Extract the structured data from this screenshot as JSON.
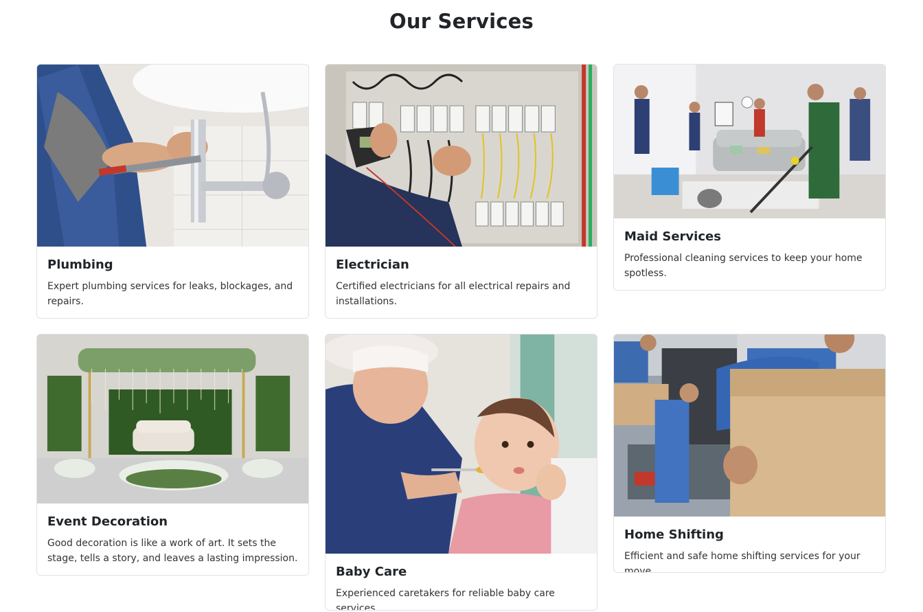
{
  "page": {
    "title": "Our Services"
  },
  "services": [
    {
      "title": "Plumbing",
      "description": "Expert plumbing services for leaks, blockages, and repairs.",
      "image": "plumber-repairing-sink-photo"
    },
    {
      "title": "Electrician",
      "description": "Certified electricians for all electrical repairs and installations.",
      "image": "electrician-testing-panel-photo"
    },
    {
      "title": "Maid Services",
      "description": "Professional cleaning services to keep your home spotless.",
      "image": "cleaning-team-living-room-photo"
    },
    {
      "title": "Event Decoration",
      "description": "Good decoration is like a work of art. It sets the stage, tells a story, and leaves a lasting impression.",
      "image": "floral-event-stage-photo"
    },
    {
      "title": "Baby Care",
      "description": "Experienced caretakers for reliable baby care services.",
      "image": "caretaker-feeding-baby-photo"
    },
    {
      "title": "Home Shifting",
      "description": "Efficient and safe home shifting services for your move.",
      "image": "movers-carrying-boxes-photo"
    }
  ]
}
